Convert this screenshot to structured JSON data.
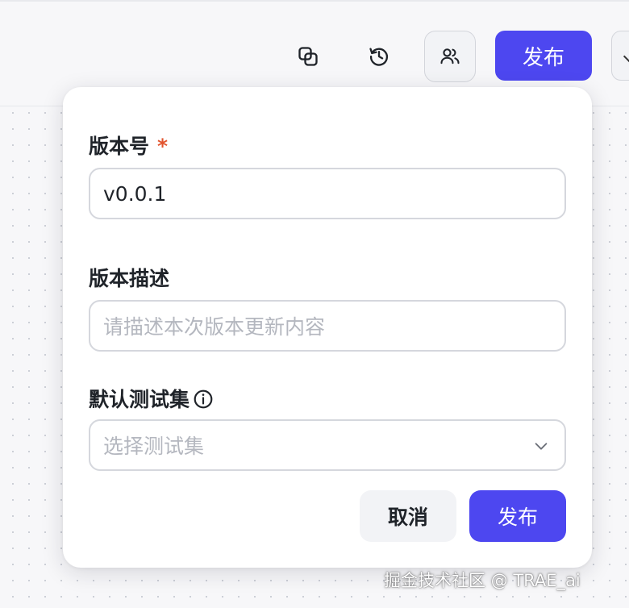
{
  "toolbar": {
    "copy_icon": "copy-icon",
    "history_icon": "history-icon",
    "users_icon": "users-icon",
    "publish_label": "发布"
  },
  "publish_dialog": {
    "version": {
      "label": "版本号",
      "required_mark": "*",
      "value": "v0.0.1"
    },
    "description": {
      "label": "版本描述",
      "placeholder": "请描述本次版本更新内容"
    },
    "test_set": {
      "label": "默认测试集",
      "info_icon": "info-icon",
      "placeholder": "选择测试集",
      "dropdown_icon": "chevron-down-icon"
    },
    "cancel_label": "取消",
    "submit_label": "发布"
  },
  "watermark": "掘金技术社区 @ TRAE_ai",
  "colors": {
    "primary": "#4d47f0",
    "required": "#e2552f",
    "placeholder": "#b4b7bf"
  }
}
